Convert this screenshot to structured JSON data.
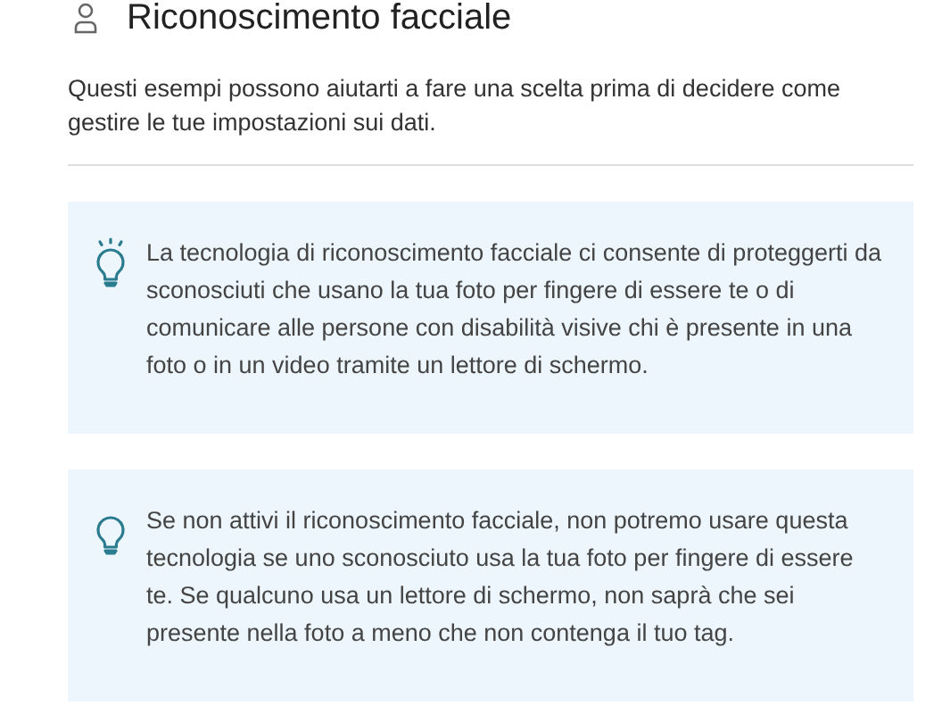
{
  "header": {
    "title": "Riconoscimento facciale"
  },
  "intro": "Questi esempi possono aiutarti a fare una scelta prima di decidere come gestire le tue impostazioni sui dati.",
  "tips": [
    {
      "lit": true,
      "text": "La tecnologia di riconoscimento facciale ci consente di proteggerti da sconosciuti che usano la tua foto per fingere di essere te o di comunicare alle persone con disabilità visive chi è presente in una foto o in un video tramite un lettore di schermo."
    },
    {
      "lit": false,
      "text": "Se non attivi il riconoscimento facciale, non potremo usare questa tecnologia se uno sconosciuto usa la tua foto per fingere di essere te. Se qualcuno usa un lettore di schermo, non saprà che sei presente nella foto a meno che non contenga il tuo tag."
    }
  ]
}
